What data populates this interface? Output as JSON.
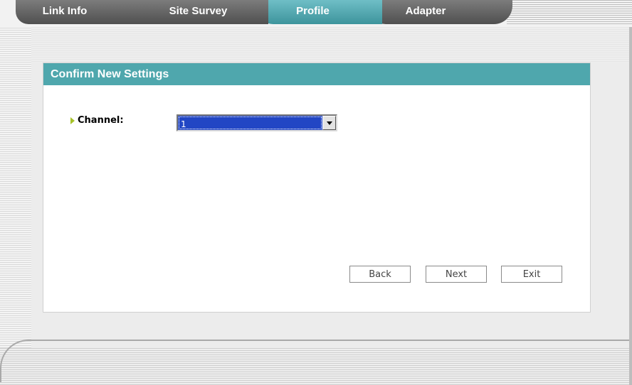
{
  "tabs": [
    {
      "label": "Link Info",
      "active": false
    },
    {
      "label": "Site Survey",
      "active": false
    },
    {
      "label": "Profile",
      "active": true
    },
    {
      "label": "Adapter",
      "active": false
    }
  ],
  "panel": {
    "title": "Confirm New Settings",
    "channel_label": "Channel:",
    "channel_value": "1"
  },
  "buttons": {
    "back": "Back",
    "next": "Next",
    "exit": "Exit"
  },
  "colors": {
    "accent": "#4fa7ad",
    "active_tab": "#4fa7ad",
    "inactive_tab": "#666666",
    "select_highlight": "#2246c4",
    "bullet": "#a6c22a"
  },
  "icons": {
    "bullet": "chevron-right-icon",
    "dropdown": "chevron-down-icon"
  }
}
